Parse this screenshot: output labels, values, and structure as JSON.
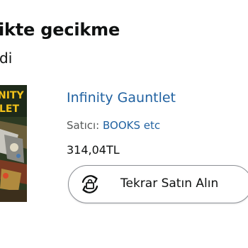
{
  "order": {
    "heading": "ikte gecikme",
    "subheading": "di"
  },
  "item": {
    "title": "Infinity Gauntlet",
    "seller_prefix": "Satıcı:",
    "seller_name": "BOOKS etc",
    "price": "314,04TL",
    "cover_text": "NITY\nLET"
  },
  "actions": {
    "buy_again_label": "Tekrar Satın Alın",
    "buy_again_icon": "buy-again-cycle-bag-icon"
  },
  "colors": {
    "link": "#2162a1",
    "text": "#0f1111",
    "muted": "#565959",
    "button_border": "#8d9096"
  }
}
